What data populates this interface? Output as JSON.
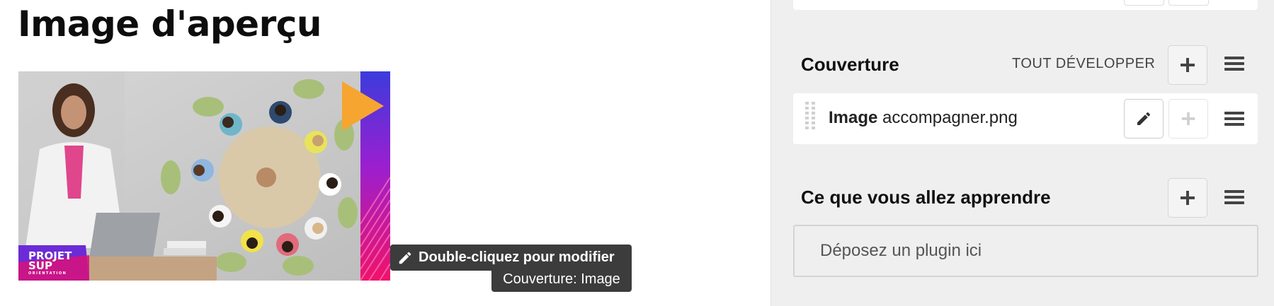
{
  "main": {
    "heading": "Image d'aperçu",
    "preview_logo": {
      "line1": "PROJET",
      "line2": "SUP",
      "line3": "ORIENTATION"
    },
    "tooltip": {
      "primary": "Double-cliquez pour modifier",
      "secondary": "Couverture: Image"
    }
  },
  "panel": {
    "sections": [
      {
        "title": "Couverture",
        "expand_label": "TOUT DÉVELOPPER",
        "plugins": [
          {
            "type": "Image",
            "name": "accompagner.png"
          }
        ]
      },
      {
        "title": "Ce que vous allez apprendre",
        "dropzone_text": "Déposez un plugin ici"
      }
    ]
  },
  "colors": {
    "panel_bg": "#efefef",
    "tooltip_bg": "#3c3c3c",
    "stripe_blue": "#3b3bdc",
    "stripe_magenta": "#e0127a",
    "triangle_orange": "#f6a531"
  },
  "icons": [
    "plus-icon",
    "hamburger-icon",
    "pencil-icon",
    "drag-handle-icon"
  ]
}
